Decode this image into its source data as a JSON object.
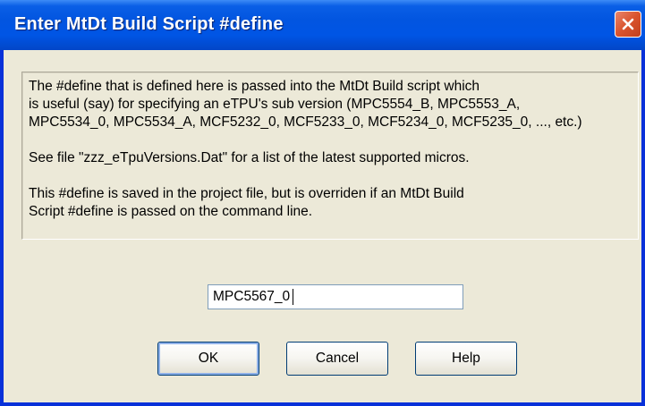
{
  "window": {
    "title": "Enter MtDt Build Script #define"
  },
  "info": {
    "paragraph1": [
      "The #define that is defined here is passed into the MtDt Build script which",
      "is useful (say) for specifying an eTPU's sub version (MPC5554_B, MPC5553_A,",
      "MPC5534_0, MPC5534_A, MCF5232_0, MCF5233_0, MCF5234_0, MCF5235_0, ..., etc.)"
    ],
    "paragraph2": "See file \"zzz_eTpuVersions.Dat\" for a list of the latest supported micros.",
    "paragraph3": [
      "This #define is saved in the project file, but is overriden if an MtDt Build",
      "Script #define is passed on the command line."
    ]
  },
  "define_input": {
    "value": "MPC5567_0"
  },
  "buttons": {
    "ok": "OK",
    "cancel": "Cancel",
    "help": "Help"
  },
  "icons": {
    "close": "close-icon"
  },
  "colors": {
    "titlebar": "#0055e5",
    "close_button": "#d9532d",
    "dialog_background": "#ece9d8"
  }
}
